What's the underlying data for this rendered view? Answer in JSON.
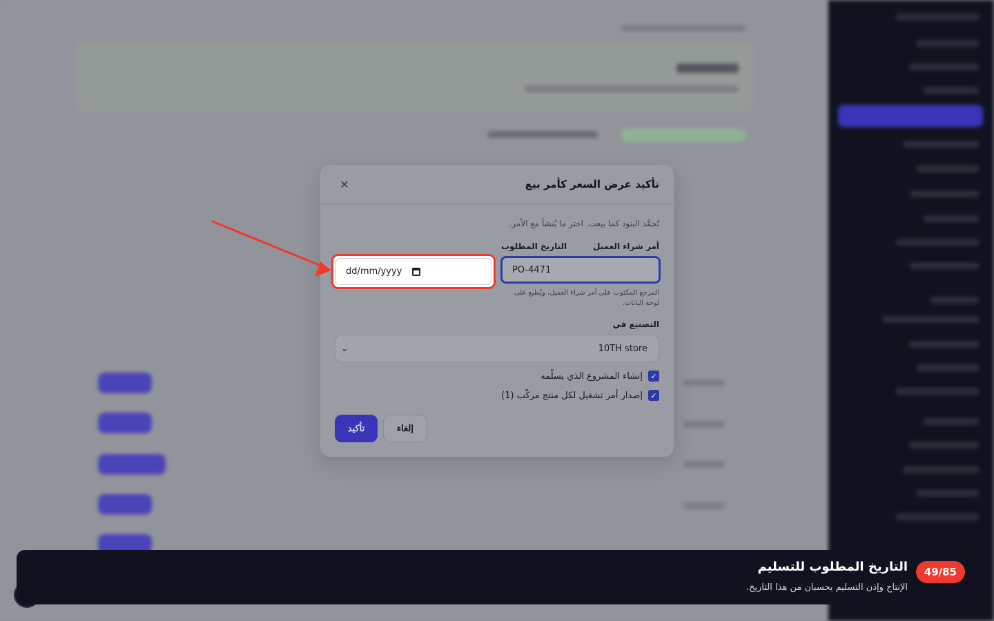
{
  "modal": {
    "title": "تأكيد عرض السعر كأمر بيع",
    "description": "تُجمَّد البنود كما بيعت. اختر ما يُنشأ مع الأمر.",
    "po_label": "أمر شراء العميل",
    "po_value": "PO-4471",
    "po_helper": "المرجع المكتوب على أمر شراء العميل، ويُطبع على لوحة البانات.",
    "date_label": "التاريخ المطلوب",
    "date_placeholder": "dd/mm/yyyy",
    "manufacture_label": "التصنيع في",
    "manufacture_value": "10TH store",
    "checkbox_project": "إنشاء المشروع الذي يسلّمه",
    "checkbox_work_order": "إصدار أمر تشغيل لكل منتج مركّب (1)",
    "confirm_label": "تأكيد",
    "cancel_label": "إلغاء"
  },
  "banner": {
    "step": "49/85",
    "title": "التاريخ المطلوب للتسليم",
    "subtitle": "الإنتاج وإذن التسليم يحسبان من هذا التاريخ."
  },
  "colors": {
    "accent": "#3a34b8",
    "highlight": "#f03a2e",
    "banner_bg": "#10131f"
  }
}
